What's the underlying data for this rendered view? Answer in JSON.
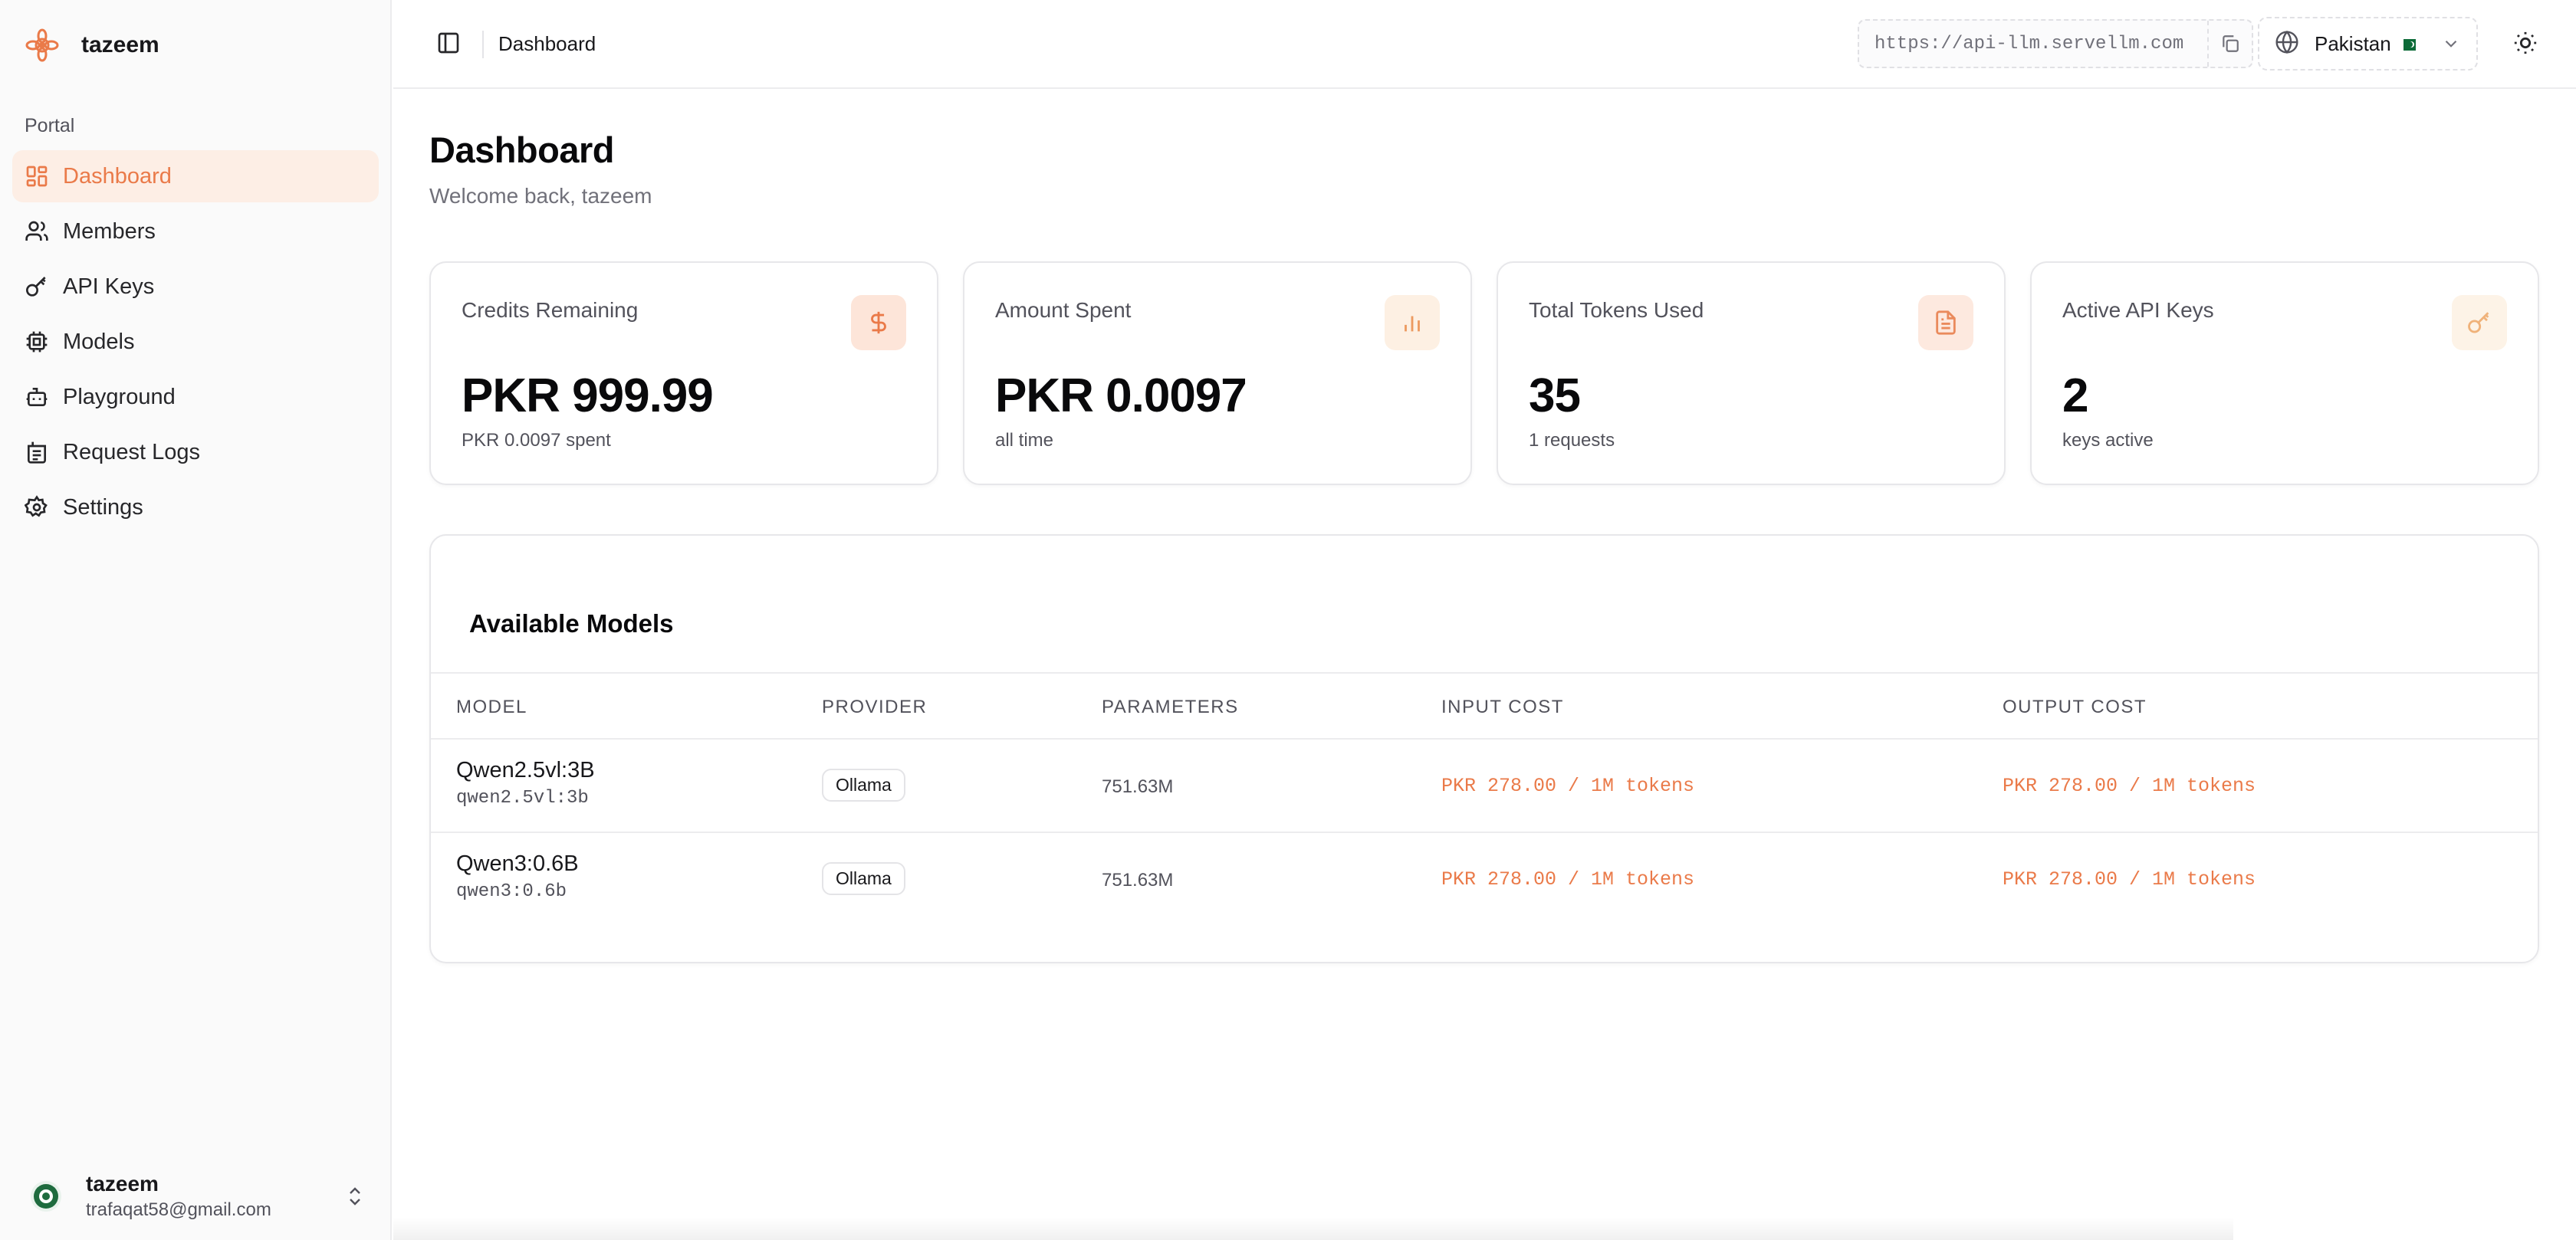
{
  "brand": {
    "name": "tazeem"
  },
  "sidebar": {
    "section_label": "Portal",
    "items": [
      {
        "label": "Dashboard",
        "icon": "dashboard-icon",
        "active": true
      },
      {
        "label": "Members",
        "icon": "users-icon"
      },
      {
        "label": "API Keys",
        "icon": "key-icon"
      },
      {
        "label": "Models",
        "icon": "chip-icon"
      },
      {
        "label": "Playground",
        "icon": "bot-icon"
      },
      {
        "label": "Request Logs",
        "icon": "logs-icon"
      },
      {
        "label": "Settings",
        "icon": "gear-icon"
      }
    ]
  },
  "user": {
    "name": "tazeem",
    "email": "trafaqat58@gmail.com"
  },
  "topbar": {
    "title": "Dashboard",
    "api_url": "https://api-llm.servellm.com",
    "region": "Pakistan"
  },
  "page": {
    "title": "Dashboard",
    "subtitle": "Welcome back, tazeem"
  },
  "stats": [
    {
      "label": "Credits Remaining",
      "value": "PKR 999.99",
      "sub": "PKR 0.0097 spent",
      "icon": "dollar-icon"
    },
    {
      "label": "Amount Spent",
      "value": "PKR 0.0097",
      "sub": "all time",
      "icon": "bar-chart-icon"
    },
    {
      "label": "Total Tokens Used",
      "value": "35",
      "sub": "1 requests",
      "icon": "document-icon"
    },
    {
      "label": "Active API Keys",
      "value": "2",
      "sub": "keys active",
      "icon": "key-icon"
    }
  ],
  "models": {
    "title": "Available Models",
    "columns": [
      "MODEL",
      "PROVIDER",
      "PARAMETERS",
      "INPUT COST",
      "OUTPUT COST"
    ],
    "rows": [
      {
        "name": "Qwen2.5vl:3B",
        "id": "qwen2.5vl:3b",
        "provider": "Ollama",
        "parameters": "751.63M",
        "input_cost": "PKR 278.00 / 1M tokens",
        "output_cost": "PKR 278.00 / 1M tokens"
      },
      {
        "name": "Qwen3:0.6B",
        "id": "qwen3:0.6b",
        "provider": "Ollama",
        "parameters": "751.63M",
        "input_cost": "PKR 278.00 / 1M tokens",
        "output_cost": "PKR 278.00 / 1M tokens"
      }
    ]
  },
  "colors": {
    "accent": "#ea7a49",
    "accent_bg": "#fdeee5",
    "icon_bg_1": "#fde5d9",
    "icon_bg_2": "#fdf0e3",
    "icon_bg_3": "#fde9df",
    "icon_bg_4": "#fdf3e7"
  }
}
